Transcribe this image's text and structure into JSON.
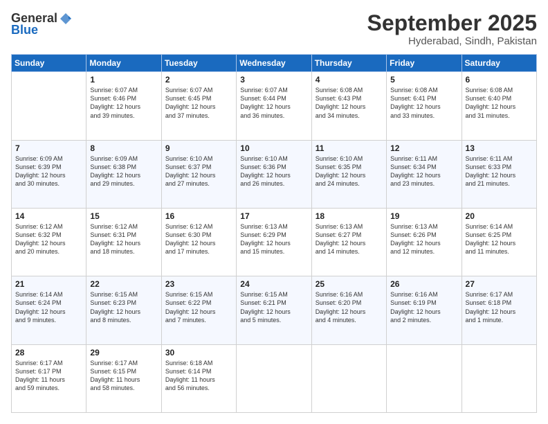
{
  "header": {
    "logo_line1": "General",
    "logo_line2": "Blue",
    "month": "September 2025",
    "location": "Hyderabad, Sindh, Pakistan"
  },
  "weekdays": [
    "Sunday",
    "Monday",
    "Tuesday",
    "Wednesday",
    "Thursday",
    "Friday",
    "Saturday"
  ],
  "weeks": [
    [
      {
        "day": "",
        "info": ""
      },
      {
        "day": "1",
        "info": "Sunrise: 6:07 AM\nSunset: 6:46 PM\nDaylight: 12 hours\nand 39 minutes."
      },
      {
        "day": "2",
        "info": "Sunrise: 6:07 AM\nSunset: 6:45 PM\nDaylight: 12 hours\nand 37 minutes."
      },
      {
        "day": "3",
        "info": "Sunrise: 6:07 AM\nSunset: 6:44 PM\nDaylight: 12 hours\nand 36 minutes."
      },
      {
        "day": "4",
        "info": "Sunrise: 6:08 AM\nSunset: 6:43 PM\nDaylight: 12 hours\nand 34 minutes."
      },
      {
        "day": "5",
        "info": "Sunrise: 6:08 AM\nSunset: 6:41 PM\nDaylight: 12 hours\nand 33 minutes."
      },
      {
        "day": "6",
        "info": "Sunrise: 6:08 AM\nSunset: 6:40 PM\nDaylight: 12 hours\nand 31 minutes."
      }
    ],
    [
      {
        "day": "7",
        "info": "Sunrise: 6:09 AM\nSunset: 6:39 PM\nDaylight: 12 hours\nand 30 minutes."
      },
      {
        "day": "8",
        "info": "Sunrise: 6:09 AM\nSunset: 6:38 PM\nDaylight: 12 hours\nand 29 minutes."
      },
      {
        "day": "9",
        "info": "Sunrise: 6:10 AM\nSunset: 6:37 PM\nDaylight: 12 hours\nand 27 minutes."
      },
      {
        "day": "10",
        "info": "Sunrise: 6:10 AM\nSunset: 6:36 PM\nDaylight: 12 hours\nand 26 minutes."
      },
      {
        "day": "11",
        "info": "Sunrise: 6:10 AM\nSunset: 6:35 PM\nDaylight: 12 hours\nand 24 minutes."
      },
      {
        "day": "12",
        "info": "Sunrise: 6:11 AM\nSunset: 6:34 PM\nDaylight: 12 hours\nand 23 minutes."
      },
      {
        "day": "13",
        "info": "Sunrise: 6:11 AM\nSunset: 6:33 PM\nDaylight: 12 hours\nand 21 minutes."
      }
    ],
    [
      {
        "day": "14",
        "info": "Sunrise: 6:12 AM\nSunset: 6:32 PM\nDaylight: 12 hours\nand 20 minutes."
      },
      {
        "day": "15",
        "info": "Sunrise: 6:12 AM\nSunset: 6:31 PM\nDaylight: 12 hours\nand 18 minutes."
      },
      {
        "day": "16",
        "info": "Sunrise: 6:12 AM\nSunset: 6:30 PM\nDaylight: 12 hours\nand 17 minutes."
      },
      {
        "day": "17",
        "info": "Sunrise: 6:13 AM\nSunset: 6:29 PM\nDaylight: 12 hours\nand 15 minutes."
      },
      {
        "day": "18",
        "info": "Sunrise: 6:13 AM\nSunset: 6:27 PM\nDaylight: 12 hours\nand 14 minutes."
      },
      {
        "day": "19",
        "info": "Sunrise: 6:13 AM\nSunset: 6:26 PM\nDaylight: 12 hours\nand 12 minutes."
      },
      {
        "day": "20",
        "info": "Sunrise: 6:14 AM\nSunset: 6:25 PM\nDaylight: 12 hours\nand 11 minutes."
      }
    ],
    [
      {
        "day": "21",
        "info": "Sunrise: 6:14 AM\nSunset: 6:24 PM\nDaylight: 12 hours\nand 9 minutes."
      },
      {
        "day": "22",
        "info": "Sunrise: 6:15 AM\nSunset: 6:23 PM\nDaylight: 12 hours\nand 8 minutes."
      },
      {
        "day": "23",
        "info": "Sunrise: 6:15 AM\nSunset: 6:22 PM\nDaylight: 12 hours\nand 7 minutes."
      },
      {
        "day": "24",
        "info": "Sunrise: 6:15 AM\nSunset: 6:21 PM\nDaylight: 12 hours\nand 5 minutes."
      },
      {
        "day": "25",
        "info": "Sunrise: 6:16 AM\nSunset: 6:20 PM\nDaylight: 12 hours\nand 4 minutes."
      },
      {
        "day": "26",
        "info": "Sunrise: 6:16 AM\nSunset: 6:19 PM\nDaylight: 12 hours\nand 2 minutes."
      },
      {
        "day": "27",
        "info": "Sunrise: 6:17 AM\nSunset: 6:18 PM\nDaylight: 12 hours\nand 1 minute."
      }
    ],
    [
      {
        "day": "28",
        "info": "Sunrise: 6:17 AM\nSunset: 6:17 PM\nDaylight: 11 hours\nand 59 minutes."
      },
      {
        "day": "29",
        "info": "Sunrise: 6:17 AM\nSunset: 6:15 PM\nDaylight: 11 hours\nand 58 minutes."
      },
      {
        "day": "30",
        "info": "Sunrise: 6:18 AM\nSunset: 6:14 PM\nDaylight: 11 hours\nand 56 minutes."
      },
      {
        "day": "",
        "info": ""
      },
      {
        "day": "",
        "info": ""
      },
      {
        "day": "",
        "info": ""
      },
      {
        "day": "",
        "info": ""
      }
    ]
  ]
}
